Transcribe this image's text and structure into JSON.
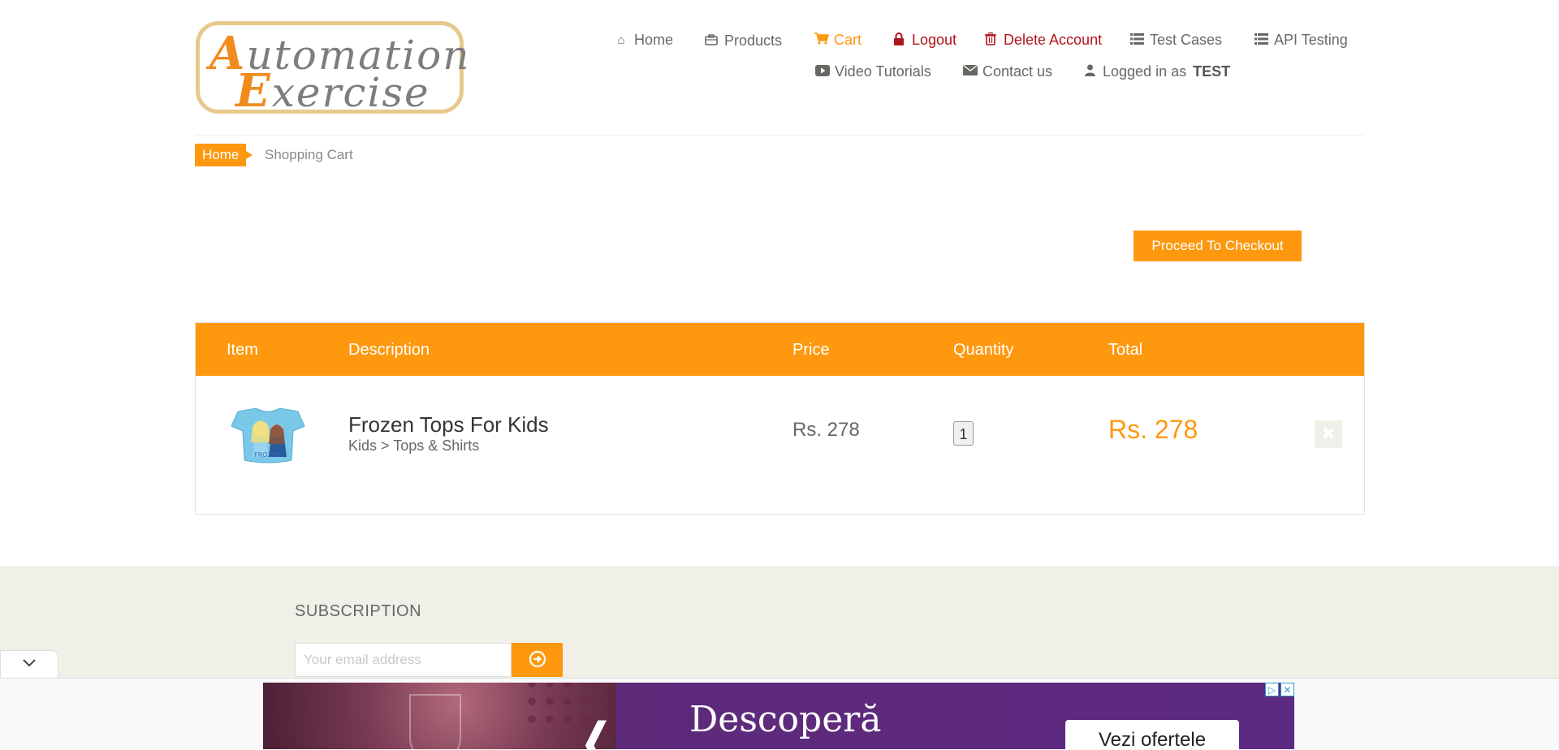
{
  "logo": {
    "line1_cap": "A",
    "line1_rest": "utomation",
    "line2_cap": "E",
    "line2_rest": "xercise"
  },
  "nav": {
    "home": "Home",
    "products": "Products",
    "cart": "Cart",
    "logout": "Logout",
    "delete_account": "Delete Account",
    "test_cases": "Test Cases",
    "api_testing": "API Testing",
    "video_tutorials": "Video Tutorials",
    "contact_us": "Contact us",
    "logged_in_prefix": "Logged in as",
    "username": "TEST"
  },
  "breadcrumb": {
    "home": "Home",
    "current": "Shopping Cart"
  },
  "checkout_label": "Proceed To Checkout",
  "table": {
    "headers": [
      "Item",
      "Description",
      "Price",
      "Quantity",
      "Total"
    ],
    "rows": [
      {
        "name": "Frozen Tops For Kids",
        "category": "Kids > Tops & Shirts",
        "price": "Rs. 278",
        "quantity": "1",
        "total": "Rs. 278"
      }
    ]
  },
  "footer": {
    "subscription_title": "SUBSCRIPTION",
    "email_placeholder": "Your email address"
  },
  "ad": {
    "headline": "Descoperă",
    "button": "Vezi ofertele"
  },
  "colors": {
    "accent": "#fe980f",
    "danger": "#b0141c",
    "footer_bg": "#f0f0e9"
  },
  "icons": [
    "home-icon",
    "briefcase-icon",
    "cart-icon",
    "lock-icon",
    "trash-icon",
    "list-icon",
    "youtube-icon",
    "envelope-icon",
    "user-icon",
    "close-icon",
    "arrow-circle-right-icon",
    "chevron-down-icon"
  ]
}
